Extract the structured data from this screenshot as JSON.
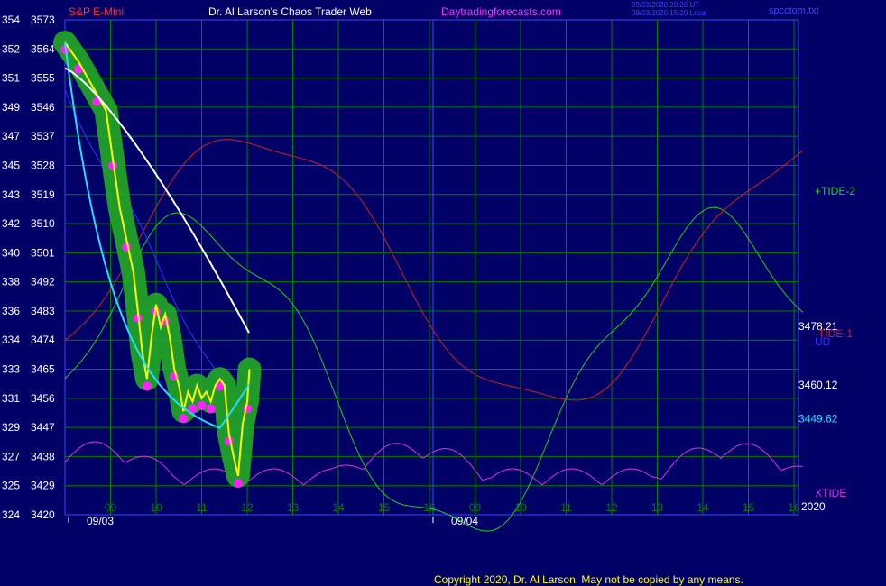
{
  "header": {
    "symbol": "S&P E-Mini",
    "title": "Dr. Al Larson's Chaos Trader Web",
    "site": "Daytradingforecasts.com",
    "timestamp_ut": "09/03/2020 20:20 UT",
    "timestamp_local": "09/03/2020 15:20 Local",
    "file": "spcctom.txt"
  },
  "footer": {
    "copyright": "Copyright 2020, Dr. Al Larson. May not be copied by any means."
  },
  "colors": {
    "background": "#000066",
    "grid": "#008000",
    "axis_text": "#ffffff",
    "axis_border": "#4444ff",
    "price_line": "#ffff00",
    "price_band": "#22aa22",
    "dots": "#ff22ff",
    "ma_fast": "#22ddff",
    "ma_slow": "#ffffff",
    "ma_blue": "#3333ff",
    "tide_plus": "#22cc22",
    "tide_minus": "#cc2222",
    "xtide": "#dd33dd"
  },
  "chart_data": {
    "type": "line",
    "y_left_outer_ticks": [
      "354",
      "352",
      "351",
      "349",
      "347",
      "345",
      "343",
      "342",
      "340",
      "338",
      "336",
      "334",
      "333",
      "331",
      "329",
      "327",
      "325",
      "324"
    ],
    "y_left_inner_ticks": [
      "3573",
      "3564",
      "3555",
      "3546",
      "3537",
      "3528",
      "3519",
      "3510",
      "3501",
      "3492",
      "3483",
      "3474",
      "3465",
      "3456",
      "3447",
      "3438",
      "3429",
      "3420"
    ],
    "ylim": [
      3420,
      3573
    ],
    "x_hours": [
      "09",
      "10",
      "11",
      "12",
      "13",
      "14",
      "15",
      "16",
      "09",
      "10",
      "11",
      "12",
      "13",
      "14",
      "15",
      "16"
    ],
    "x_dates": [
      "09/03",
      "09/04"
    ],
    "year": "2020",
    "price_series": [
      [
        0,
        3566
      ],
      [
        0.15,
        3563
      ],
      [
        0.3,
        3560
      ],
      [
        0.5,
        3555
      ],
      [
        0.7,
        3550
      ],
      [
        0.9,
        3545
      ],
      [
        1.05,
        3530
      ],
      [
        1.2,
        3515
      ],
      [
        1.35,
        3505
      ],
      [
        1.5,
        3495
      ],
      [
        1.6,
        3483
      ],
      [
        1.7,
        3470
      ],
      [
        1.8,
        3462
      ],
      [
        1.9,
        3475
      ],
      [
        2.0,
        3485
      ],
      [
        2.1,
        3478
      ],
      [
        2.2,
        3482
      ],
      [
        2.3,
        3475
      ],
      [
        2.4,
        3465
      ],
      [
        2.5,
        3460
      ],
      [
        2.6,
        3452
      ],
      [
        2.7,
        3458
      ],
      [
        2.8,
        3455
      ],
      [
        2.9,
        3460
      ],
      [
        3.0,
        3456
      ],
      [
        3.1,
        3458
      ],
      [
        3.2,
        3455
      ],
      [
        3.3,
        3460
      ],
      [
        3.4,
        3462
      ],
      [
        3.5,
        3460
      ],
      [
        3.6,
        3445
      ],
      [
        3.7,
        3438
      ],
      [
        3.8,
        3432
      ],
      [
        3.9,
        3448
      ],
      [
        4.0,
        3455
      ],
      [
        4.05,
        3465
      ]
    ],
    "series": [
      {
        "name": "+TIDE-2"
      },
      {
        "name": "-TIDE-1"
      },
      {
        "name": "UD"
      },
      {
        "name": "XTIDE"
      }
    ],
    "right_labels": [
      {
        "text": "3478.21",
        "value": 3478.21,
        "color": "#ffffff"
      },
      {
        "text": "3460.12",
        "value": 3460.12,
        "color": "#ffffff"
      },
      {
        "text": "3449.62",
        "value": 3449.62,
        "color": "#22ddff"
      }
    ]
  }
}
